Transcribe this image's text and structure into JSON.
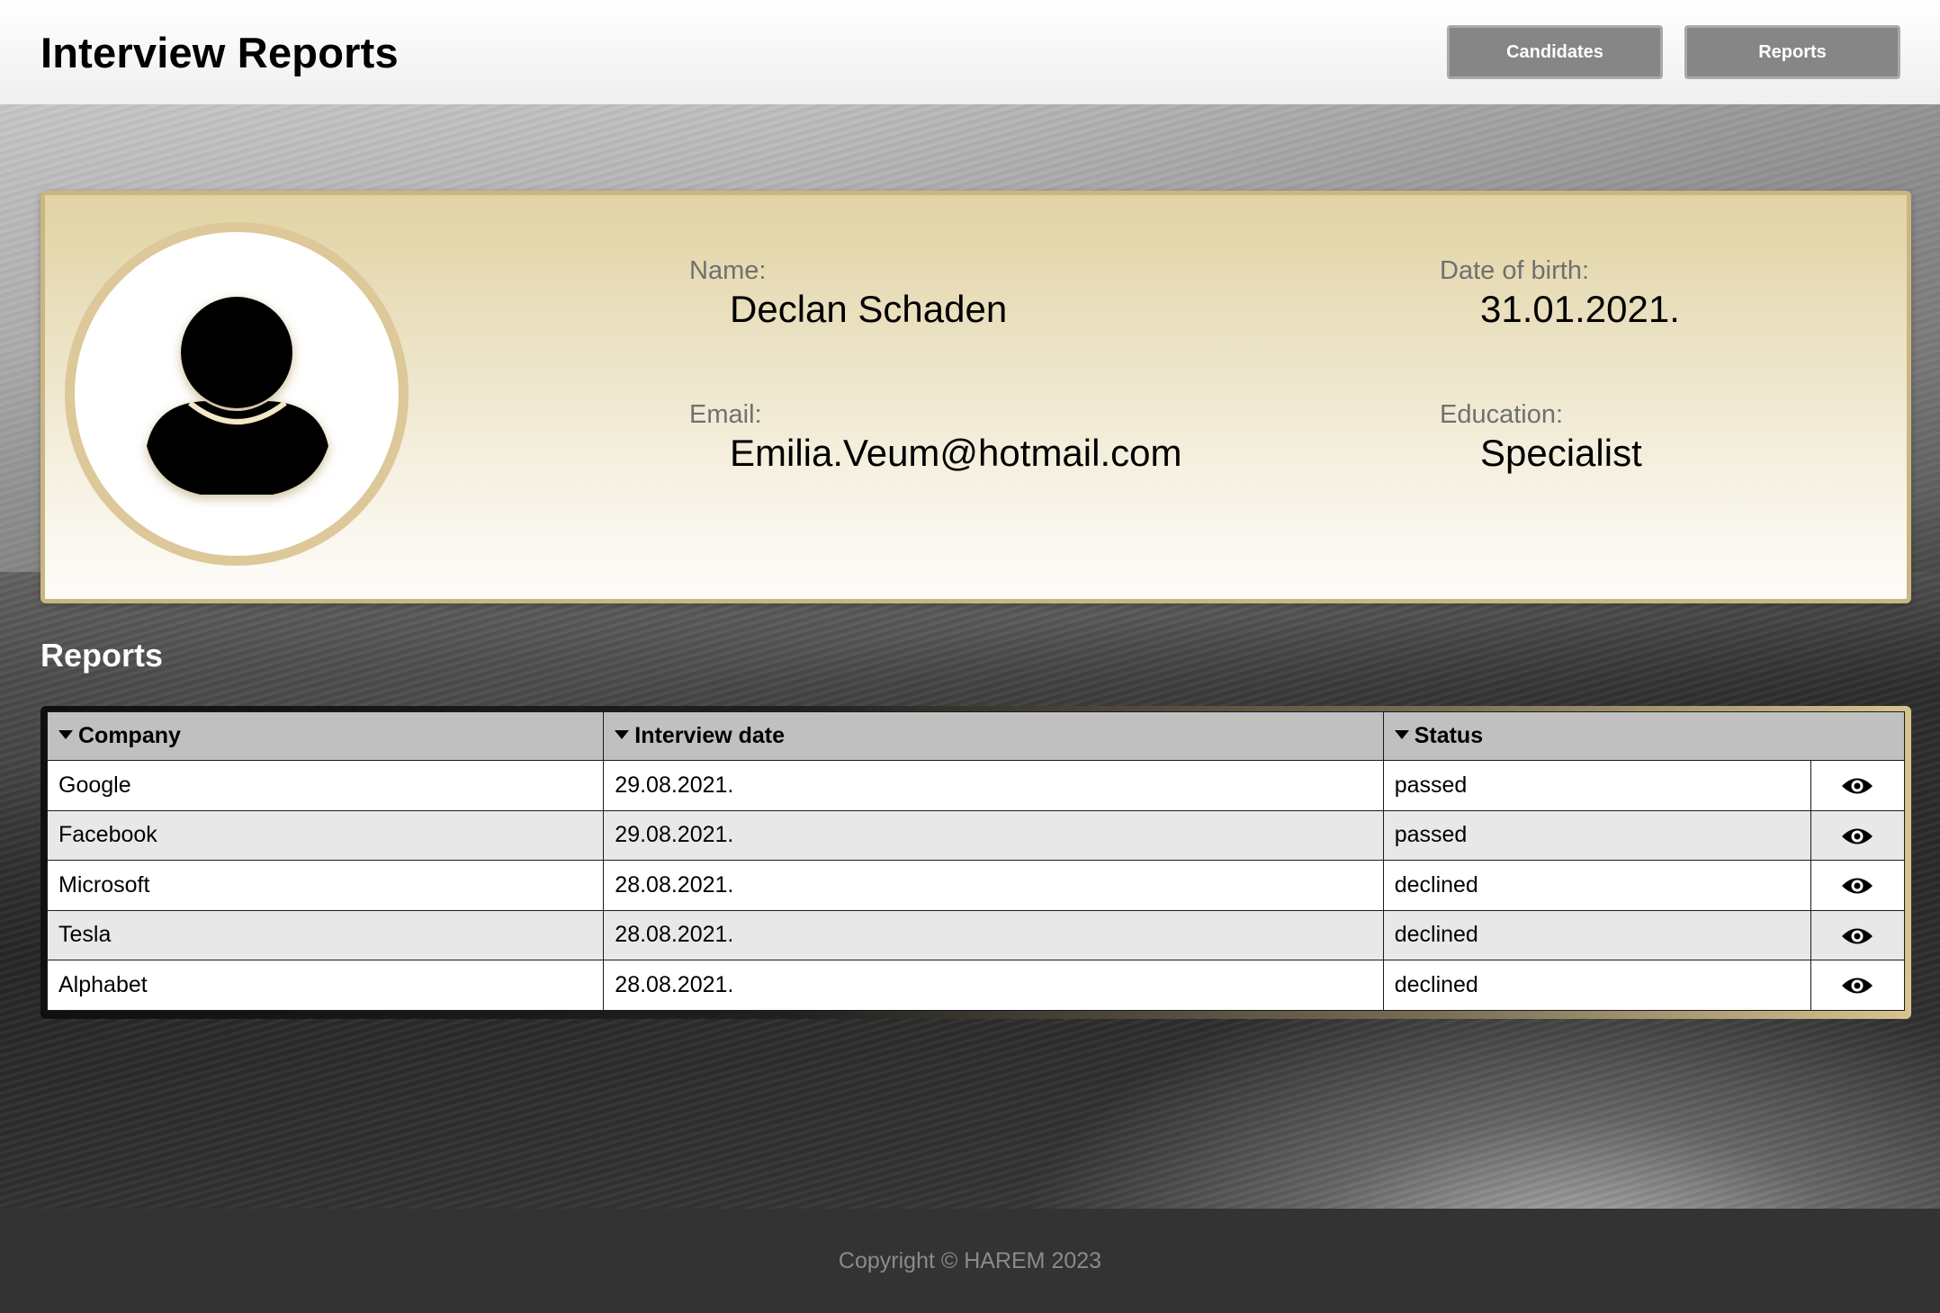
{
  "header": {
    "title": "Interview Reports",
    "nav": [
      {
        "label": "Candidates"
      },
      {
        "label": "Reports"
      }
    ]
  },
  "profile": {
    "avatar_icon": "user-silhouette-icon",
    "name_label": "Name:",
    "name": "Declan Schaden",
    "dob_label": "Date of birth:",
    "dob": "31.01.2021.",
    "email_label": "Email:",
    "email": "Emilia.Veum@hotmail.com",
    "education_label": "Education:",
    "education": "Specialist"
  },
  "reports": {
    "heading": "Reports",
    "columns": [
      "Company",
      "Interview date",
      "Status"
    ],
    "rows": [
      {
        "company": "Google",
        "date": "29.08.2021.",
        "status": "passed"
      },
      {
        "company": "Facebook",
        "date": "29.08.2021.",
        "status": "passed"
      },
      {
        "company": "Microsoft",
        "date": "28.08.2021.",
        "status": "declined"
      },
      {
        "company": "Tesla",
        "date": "28.08.2021.",
        "status": "declined"
      },
      {
        "company": "Alphabet",
        "date": "28.08.2021.",
        "status": "declined"
      }
    ],
    "action_icon": "eye-icon"
  },
  "footer": {
    "copyright": "Copyright © HAREM 2023"
  },
  "colors": {
    "card_gold": "#dcc898",
    "header_bg": "#c0c0c0",
    "nav_button": "#868686",
    "footer_bg": "#333333"
  }
}
